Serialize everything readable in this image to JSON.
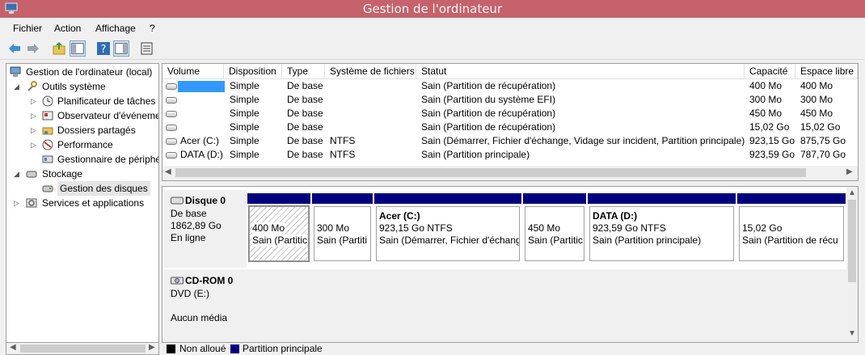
{
  "window": {
    "title": "Gestion de l'ordinateur"
  },
  "menu": [
    "Fichier",
    "Action",
    "Affichage",
    "?"
  ],
  "toolbar": {
    "icons": [
      "back-arrow-icon",
      "forward-arrow-icon",
      "up-folder-icon",
      "show-hide-tree-icon",
      "help-icon",
      "properties-panel-icon",
      "export-list-icon"
    ]
  },
  "tree": {
    "root": "Gestion de l'ordinateur (local)",
    "system_tools": "Outils système",
    "task_scheduler": "Planificateur de tâches",
    "event_viewer": "Observateur d'événeme",
    "shared_folders": "Dossiers partagés",
    "performance": "Performance",
    "device_manager": "Gestionnaire de périphé",
    "storage": "Stockage",
    "disk_management": "Gestion des disques",
    "services": "Services et applications"
  },
  "volumes": {
    "columns": [
      "Volume",
      "Disposition",
      "Type",
      "Système de fichiers",
      "Statut",
      "Capacité",
      "Espace libre"
    ],
    "rows": [
      {
        "volume": "",
        "layout": "Simple",
        "type": "De base",
        "fs": "",
        "status": "Sain (Partition de récupération)",
        "capacity": "400 Mo",
        "free": "400 Mo"
      },
      {
        "volume": "",
        "layout": "Simple",
        "type": "De base",
        "fs": "",
        "status": "Sain (Partition du système EFI)",
        "capacity": "300 Mo",
        "free": "300 Mo"
      },
      {
        "volume": "",
        "layout": "Simple",
        "type": "De base",
        "fs": "",
        "status": "Sain (Partition de récupération)",
        "capacity": "450 Mo",
        "free": "450 Mo"
      },
      {
        "volume": "",
        "layout": "Simple",
        "type": "De base",
        "fs": "",
        "status": "Sain (Partition de récupération)",
        "capacity": "15,02 Go",
        "free": "15,02 Go"
      },
      {
        "volume": "Acer (C:)",
        "layout": "Simple",
        "type": "De base",
        "fs": "NTFS",
        "status": "Sain (Démarrer, Fichier d'échange, Vidage sur incident, Partition principale)",
        "capacity": "923,15 Go",
        "free": "875,75 Go"
      },
      {
        "volume": "DATA (D:)",
        "layout": "Simple",
        "type": "De base",
        "fs": "NTFS",
        "status": "Sain (Partition principale)",
        "capacity": "923,59 Go",
        "free": "787,70 Go"
      }
    ]
  },
  "disk0": {
    "name": "Disque 0",
    "type": "De base",
    "size": "1862,89 Go",
    "state": "En ligne",
    "partitions": [
      {
        "label": "",
        "size": "400 Mo",
        "status": "Sain (Partitic"
      },
      {
        "label": "",
        "size": "300 Mo",
        "status": "Sain (Partiti"
      },
      {
        "label": "Acer  (C:)",
        "size": "923,15 Go NTFS",
        "status": "Sain (Démarrer, Fichier d'échang"
      },
      {
        "label": "",
        "size": "450 Mo",
        "status": "Sain (Partitic"
      },
      {
        "label": "DATA  (D:)",
        "size": "923,59 Go NTFS",
        "status": "Sain (Partition principale)"
      },
      {
        "label": "",
        "size": "15,02 Go",
        "status": "Sain (Partition de récu"
      }
    ]
  },
  "cdrom0": {
    "name": "CD-ROM 0",
    "type": "DVD (E:)",
    "media": "Aucun média"
  },
  "legend": {
    "unallocated": "Non alloué",
    "primary": "Partition principale",
    "unallocated_color": "#000000",
    "primary_color": "#00007f"
  }
}
